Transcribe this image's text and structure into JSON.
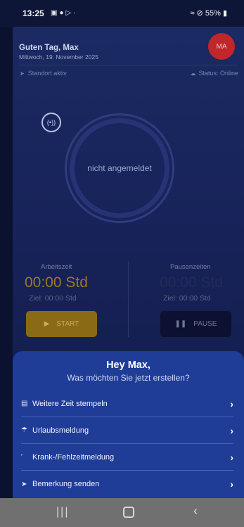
{
  "status_bar": {
    "time": "13:25",
    "left_icons": [
      "gallery-icon",
      "location-pin-icon",
      "play-store-icon",
      "dot"
    ],
    "right_text": "55%",
    "right_icons": [
      "mute-icon",
      "wifi-icon",
      "dnd-icon",
      "battery-icon"
    ]
  },
  "header": {
    "greeting": "Guten Tag, Max",
    "date": "Mittwoch, 19. November 2025",
    "avatar_initials": "MA",
    "location_text": "Standort aktiv",
    "status_text": "Status: Online"
  },
  "clock": {
    "nfc_label": "(•))",
    "status_label": "nicht angemeldet"
  },
  "work": {
    "label": "Arbeitszeit",
    "time": "00:00 Std",
    "target": "Ziel: 00:00 Std",
    "button_label": "START"
  },
  "pause": {
    "label": "Pausenzeiten",
    "time": "00:00 Std",
    "target": "Ziel: 00:00  Std",
    "button_label": "PAUSE"
  },
  "sheet": {
    "title": "Hey Max,",
    "subtitle": "Was möchten Sie jetzt erstellen?",
    "items": [
      {
        "label": "Weitere Zeit stempeln",
        "icon": "document-icon"
      },
      {
        "label": "Urlaubsmeldung",
        "icon": "umbrella-icon"
      },
      {
        "label": "Krank-/Fehlzeitmeldung",
        "icon": "thermometer-icon"
      },
      {
        "label": "Bemerkung senden",
        "icon": "send-icon"
      }
    ]
  },
  "colors": {
    "accent_gold": "#c9a227",
    "sheet_blue": "#1f3c96",
    "avatar_red": "#c0262a",
    "background": "#17235a"
  }
}
